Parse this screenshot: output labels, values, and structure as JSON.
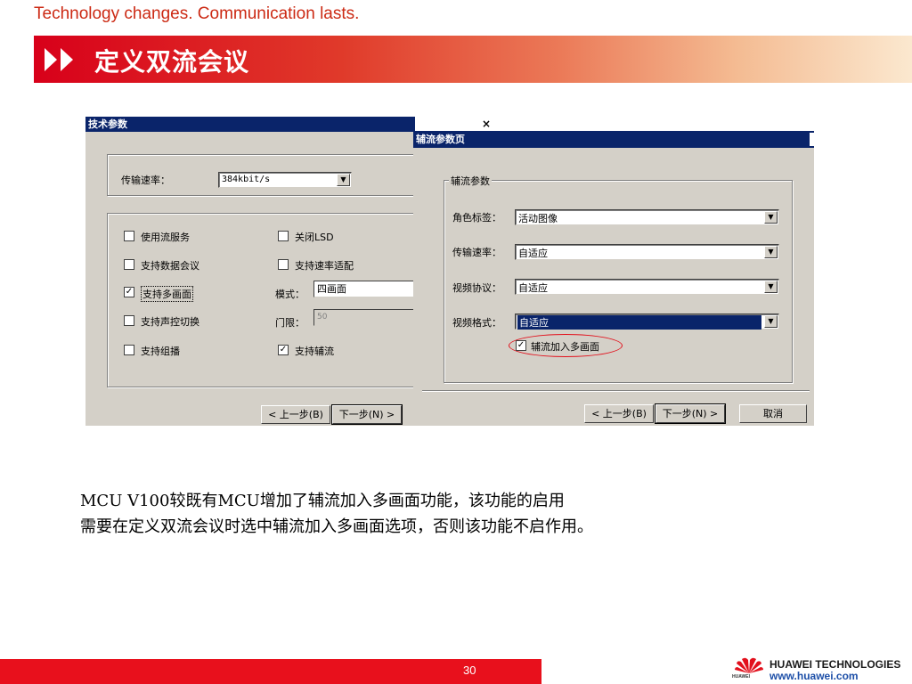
{
  "header": {
    "tagline": "Technology changes. Communication lasts.",
    "title": "定义双流会议"
  },
  "dialog1": {
    "title": "技术参数",
    "close_glyph": "×",
    "rate_label": "传输速率：",
    "rate_value": "384kbit/s",
    "options": {
      "use_stream_service": {
        "label": "使用流服务",
        "checked": false
      },
      "support_data_conf": {
        "label": "支持数据会议",
        "checked": false
      },
      "support_multipic": {
        "label": "支持多画面",
        "checked": true
      },
      "support_voice_switch": {
        "label": "支持声控切换",
        "checked": false
      },
      "support_group_broadcast": {
        "label": "支持组播",
        "checked": false
      },
      "close_lsd": {
        "label": "关闭LSD",
        "checked": false
      },
      "support_rate_adapt": {
        "label": "支持速率适配",
        "checked": false
      },
      "support_aux_stream": {
        "label": "支持辅流",
        "checked": true
      }
    },
    "mode_label": "模式：",
    "mode_value": "四画面",
    "threshold_label": "门限：",
    "threshold_value": "50",
    "prev_button": "< 上一步(B)",
    "next_button": "下一步(N) >"
  },
  "dialog2": {
    "title": "辅流参数页",
    "group_label": "辅流参数",
    "role_label": "角色标签：",
    "role_value": "活动图像",
    "rate_label": "传输速率：",
    "rate_value": "自适应",
    "protocol_label": "视频协议：",
    "protocol_value": "自适应",
    "format_label": "视频格式：",
    "format_value": "自适应",
    "aux_multipic": {
      "label": "辅流加入多画面",
      "checked": true
    },
    "prev_button": "< 上一步(B)",
    "next_button": "下一步(N) >",
    "cancel_button": "取消"
  },
  "check_glyph": "✓",
  "body": {
    "line1": "MCU V100较既有MCU增加了辅流加入多画面功能，该功能的启用",
    "line2": "需要在定义双流会议时选中辅流加入多画面选项，否则该功能不启作用。"
  },
  "footer": {
    "page_number": "30",
    "company": "HUAWEI TECHNOLOGIES",
    "url": "www.huawei.com",
    "logo_small": "HUAWEI"
  },
  "colors": {
    "accent_red": "#d8001a",
    "titlebar_blue": "#0a246a",
    "url_blue": "#1d4fa8"
  }
}
